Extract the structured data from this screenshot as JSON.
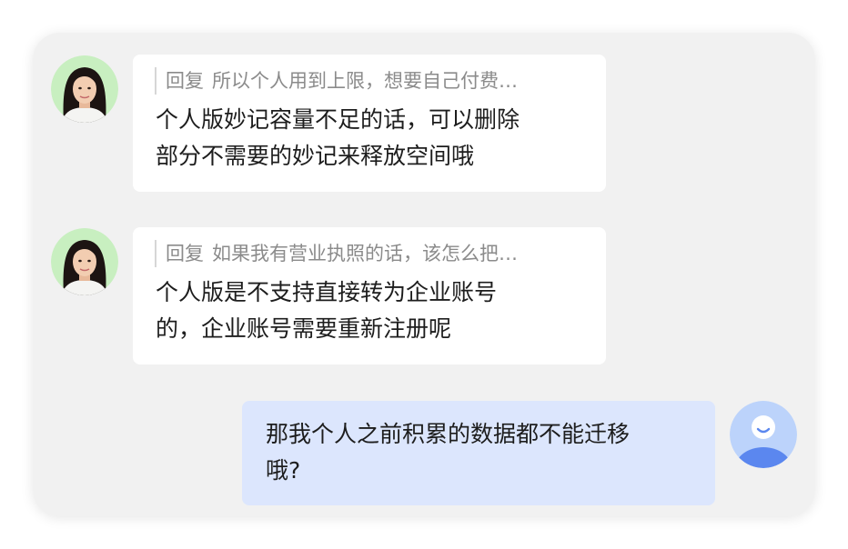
{
  "messages": [
    {
      "sender": "agent",
      "reply_prefix": "回复",
      "reply_quote": "所以个人用到上限，想要自己付费…",
      "lines": [
        "个人版妙记容量不足的话，可以删除",
        "部分不需要的妙记来释放空间哦"
      ]
    },
    {
      "sender": "agent",
      "reply_prefix": "回复",
      "reply_quote": "如果我有营业执照的话，该怎么把…",
      "lines": [
        "个人版是不支持直接转为企业账号",
        "的，企业账号需要重新注册呢"
      ]
    },
    {
      "sender": "user",
      "lines": [
        "那我个人之前积累的数据都不能迁移",
        "哦?"
      ]
    }
  ],
  "colors": {
    "window_bg": "#f1f1f1",
    "agent_bubble": "#ffffff",
    "user_bubble": "#dce6fd",
    "quote_text": "#8b8b8b",
    "body_text": "#1d1d1d",
    "agent_avatar_bg": "#c8efc0",
    "user_avatar_bg": "#bcd3fb",
    "user_avatar_figure": "#5b87ef"
  },
  "icons": {
    "agent_avatar": "woman-portrait-avatar",
    "user_avatar": "default-user-avatar"
  }
}
